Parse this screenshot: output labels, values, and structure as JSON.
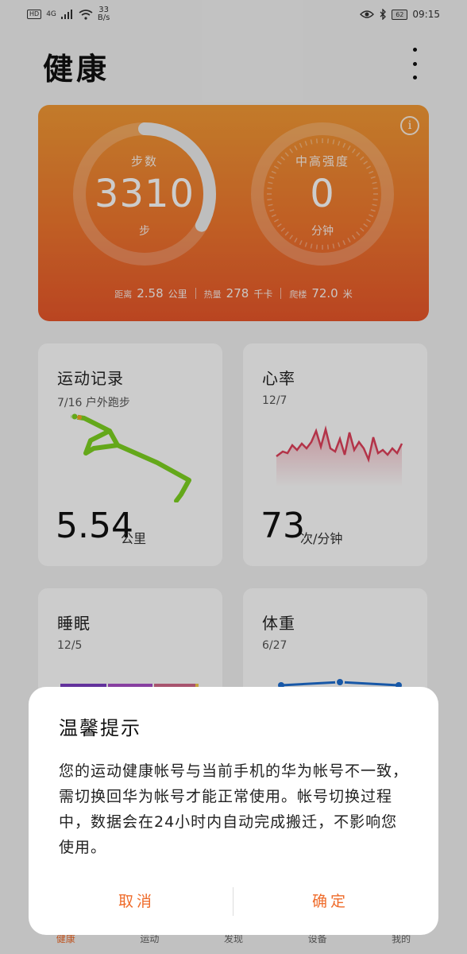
{
  "status_bar": {
    "hd": "HD",
    "network": "4G",
    "speed_value": "33",
    "speed_unit": "B/s",
    "battery": "62",
    "time": "09:15"
  },
  "header": {
    "title": "健康"
  },
  "summary": {
    "steps": {
      "label": "步数",
      "value": "3310",
      "unit": "步",
      "progress": 0.33
    },
    "intensity": {
      "label": "中高强度",
      "value": "0",
      "unit": "分钟"
    },
    "stats": [
      {
        "label": "距离",
        "value": "2.58",
        "unit": "公里"
      },
      {
        "label": "热量",
        "value": "278",
        "unit": "千卡"
      },
      {
        "label": "爬楼",
        "value": "72.0",
        "unit": "米"
      }
    ],
    "colors": {
      "card_top": "#f39a35",
      "card_bottom": "#e8562a"
    }
  },
  "cards": {
    "exercise": {
      "title": "运动记录",
      "date": "7/16 户外跑步",
      "value": "5.54",
      "unit": "公里"
    },
    "heart": {
      "title": "心率",
      "date": "12/7",
      "value": "73",
      "unit": "次/分钟"
    },
    "sleep": {
      "title": "睡眠",
      "date": "12/5"
    },
    "weight": {
      "title": "体重",
      "date": "6/27"
    }
  },
  "bottom_nav": [
    "健康",
    "运动",
    "发现",
    "设备",
    "我的"
  ],
  "dialog": {
    "title": "温馨提示",
    "body": "您的运动健康帐号与当前手机的华为帐号不一致，需切换回华为帐号才能正常使用。帐号切换过程中，数据会在24小时内自动完成搬迁，不影响您使用。",
    "cancel": "取消",
    "confirm": "确定"
  }
}
